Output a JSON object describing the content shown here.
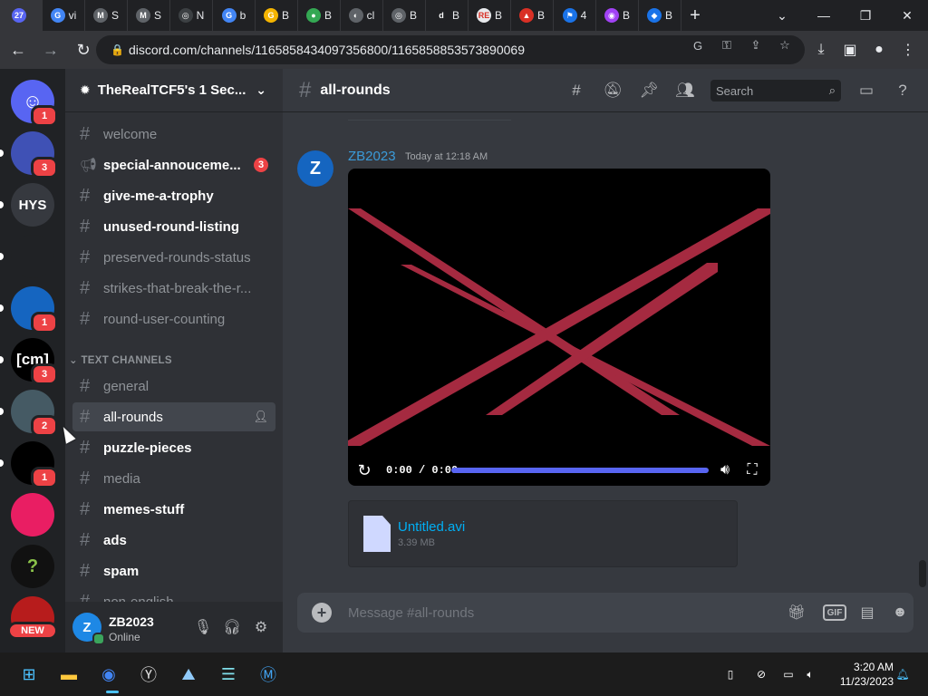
{
  "browser": {
    "tabs": [
      {
        "fav": "27",
        "label": "",
        "color": "#5865f2"
      },
      {
        "fav": "G",
        "label": "vi",
        "color": "#4285f4"
      },
      {
        "fav": "M",
        "label": "S",
        "color": "#5f6368"
      },
      {
        "fav": "M",
        "label": "S",
        "color": "#5f6368"
      },
      {
        "fav": "◎",
        "label": "N",
        "color": "#3c4043"
      },
      {
        "fav": "G",
        "label": "b",
        "color": "#4285f4"
      },
      {
        "fav": "G",
        "label": "B",
        "color": "#f4b400"
      },
      {
        "fav": "●",
        "label": "B",
        "color": "#34a853"
      },
      {
        "fav": "◐",
        "label": "cl",
        "color": "#5f6368"
      },
      {
        "fav": "◎",
        "label": "B",
        "color": "#5f6368"
      },
      {
        "fav": "d",
        "label": "B",
        "color": "#202124"
      },
      {
        "fav": "RE",
        "label": "B",
        "color": "#e8eaed"
      },
      {
        "fav": "▲",
        "label": "B",
        "color": "#d93025"
      },
      {
        "fav": "⚑",
        "label": "4",
        "color": "#1a73e8"
      },
      {
        "fav": "◉",
        "label": "B",
        "color": "#a142f4"
      },
      {
        "fav": "◆",
        "label": "B",
        "color": "#1a73e8"
      }
    ],
    "new_tab": "+",
    "url": "discord.com/channels/1165858434097356800/1165858853573890069"
  },
  "rail": {
    "servers": [
      {
        "name": "discord-home",
        "text": "",
        "badge": "1",
        "color": "#5865f2"
      },
      {
        "name": "server-checker",
        "text": "",
        "badge": "3",
        "color": "#3f51b5"
      },
      {
        "name": "server-hys",
        "text": "HYS",
        "badge": "",
        "color": "#36393f"
      },
      {
        "name": "server-fish",
        "text": "",
        "badge": "",
        "color": "#202225"
      },
      {
        "name": "server-windows",
        "text": "",
        "badge": "1",
        "color": "#1565c0"
      },
      {
        "name": "server-cm",
        "text": "[cm]",
        "badge": "3",
        "color": "#000000"
      },
      {
        "name": "server-pattern",
        "text": "",
        "badge": "2",
        "color": "#455a64"
      },
      {
        "name": "server-hexagon",
        "text": "",
        "badge": "1",
        "color": "#000000"
      },
      {
        "name": "server-face",
        "text": "",
        "badge": "",
        "color": "#e91e63"
      },
      {
        "name": "server-question",
        "text": "?",
        "badge": "",
        "color": "#111111"
      },
      {
        "name": "server-new",
        "text": "",
        "badge": "",
        "color": "#b71c1c"
      }
    ],
    "new_label": "NEW"
  },
  "guild": {
    "name": "TheRealTCF5's 1 Sec...",
    "channels": [
      {
        "name": "welcome",
        "style": "muted",
        "icon": "#"
      },
      {
        "name": "special-annouceme...",
        "style": "unread",
        "icon": "📢",
        "badge": "3"
      },
      {
        "name": "give-me-a-trophy",
        "style": "unread",
        "icon": "#"
      },
      {
        "name": "unused-round-listing",
        "style": "unread",
        "icon": "#"
      },
      {
        "name": "preserved-rounds-status",
        "style": "muted",
        "icon": "#"
      },
      {
        "name": "strikes-that-break-the-r...",
        "style": "muted",
        "icon": "#"
      },
      {
        "name": "round-user-counting",
        "style": "muted",
        "icon": "#"
      }
    ],
    "category": "TEXT CHANNELS",
    "text_channels": [
      {
        "name": "general",
        "style": "muted",
        "icon": "#"
      },
      {
        "name": "all-rounds",
        "style": "selected",
        "icon": "#"
      },
      {
        "name": "puzzle-pieces",
        "style": "unread",
        "icon": "#"
      },
      {
        "name": "media",
        "style": "muted",
        "icon": "#"
      },
      {
        "name": "memes-stuff",
        "style": "unread",
        "icon": "#"
      },
      {
        "name": "ads",
        "style": "unread",
        "icon": "#"
      },
      {
        "name": "spam",
        "style": "unread",
        "icon": "#"
      },
      {
        "name": "non-english",
        "style": "muted",
        "icon": "#"
      }
    ]
  },
  "user": {
    "name": "ZB2023",
    "status": "Online",
    "avatar_letter": "Z"
  },
  "chat": {
    "channel": "all-rounds",
    "search_placeholder": "Search",
    "message": {
      "author": "ZB2023",
      "time": "Today at 12:18 AM",
      "avatar_letter": "Z"
    },
    "video": {
      "time": "0:00 / 0:00",
      "progress": 1.0
    },
    "attachment": {
      "name": "Untitled.avi",
      "size": "3.39 MB"
    },
    "composer_placeholder": "Message #all-rounds",
    "gif_label": "GIF"
  },
  "taskbar": {
    "time": "3:20 AM",
    "date": "11/23/2023"
  },
  "colors": {
    "accent": "#5865f2",
    "danger": "#ed4245",
    "online": "#3ba55c",
    "video_lines": "#a52a40"
  }
}
